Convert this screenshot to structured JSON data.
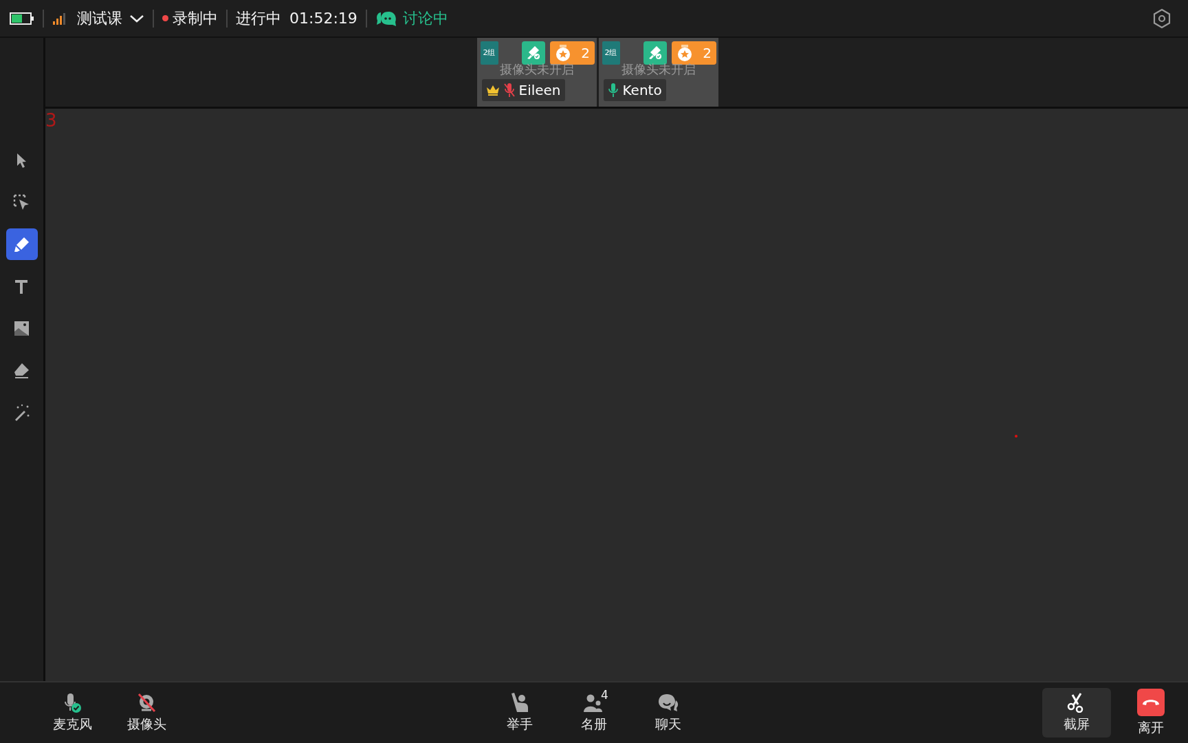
{
  "status_bar": {
    "course": "测试课",
    "recording": "录制中",
    "recording_on": true,
    "progress_label": "进行中",
    "elapsed": "01:52:19",
    "discussion": "讨论中"
  },
  "participants": [
    {
      "group": "2组",
      "award_count": "2",
      "camera_status": "摄像头未开启",
      "name": "Eileen",
      "host": true,
      "muted": true
    },
    {
      "group": "2组",
      "award_count": "2",
      "camera_status": "摄像头未开启",
      "name": "Kento",
      "host": false,
      "muted": false
    }
  ],
  "tools": [
    {
      "kind": "pointer",
      "selected": false
    },
    {
      "kind": "select",
      "selected": false
    },
    {
      "kind": "pen",
      "selected": true
    },
    {
      "kind": "text",
      "selected": false
    },
    {
      "kind": "image",
      "selected": false
    },
    {
      "kind": "eraser",
      "selected": false
    },
    {
      "kind": "wand",
      "selected": false
    }
  ],
  "whiteboard": {
    "text": "3"
  },
  "controls": {
    "left": [
      {
        "kind": "mic",
        "label": "麦克风"
      },
      {
        "kind": "camera-off",
        "label": "摄像头"
      }
    ],
    "center": [
      {
        "kind": "hand",
        "label": "举手"
      },
      {
        "kind": "roster",
        "label": "名册",
        "count": "4"
      },
      {
        "kind": "chat",
        "label": "聊天"
      }
    ],
    "right": [
      {
        "kind": "screenshot",
        "label": "截屏",
        "selected": true
      },
      {
        "kind": "leave",
        "label": "离开"
      }
    ]
  }
}
